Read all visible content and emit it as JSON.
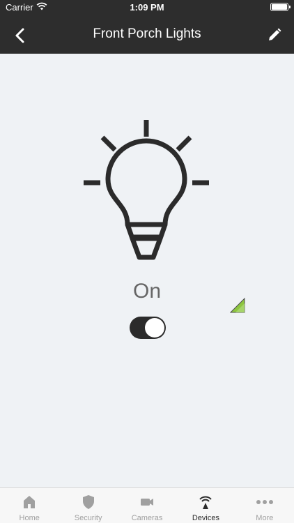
{
  "status_bar": {
    "carrier": "Carrier",
    "time": "1:09 PM"
  },
  "header": {
    "title": "Front Porch Lights"
  },
  "device": {
    "state": "On",
    "switch_on": true,
    "accent_color": "#8dc63f"
  },
  "tabbar": {
    "items": [
      {
        "label": "Home",
        "icon": "home-icon",
        "active": false
      },
      {
        "label": "Security",
        "icon": "shield-icon",
        "active": false
      },
      {
        "label": "Cameras",
        "icon": "camera-icon",
        "active": false
      },
      {
        "label": "Devices",
        "icon": "devices-icon",
        "active": true
      },
      {
        "label": "More",
        "icon": "more-icon",
        "active": false
      }
    ]
  }
}
